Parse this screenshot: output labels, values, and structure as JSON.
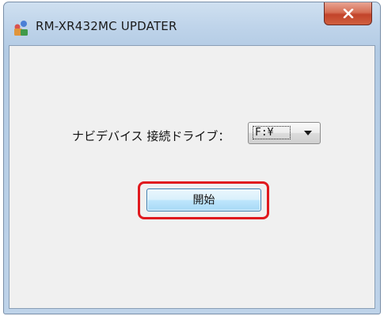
{
  "window": {
    "title": "RM-XR432MC UPDATER"
  },
  "form": {
    "drive_label": "ナビデバイス 接続ドライブ：",
    "drive_value": "F:¥",
    "start_label": "開始"
  },
  "icons": {
    "app": "app-icon",
    "close": "close-icon",
    "dropdown": "chevron-down-icon"
  },
  "colors": {
    "highlight": "#e0191e",
    "close_button": "#c9553b"
  }
}
